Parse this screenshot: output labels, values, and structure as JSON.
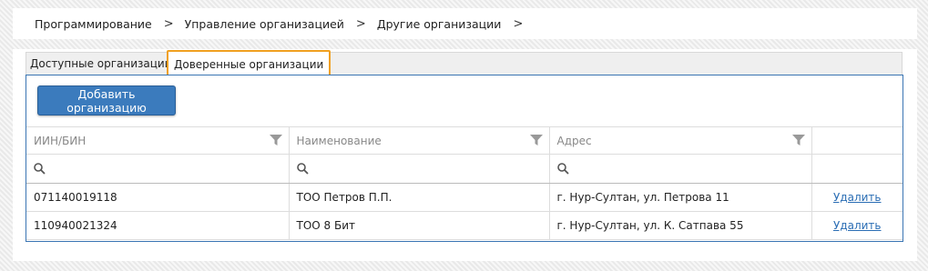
{
  "breadcrumb": [
    {
      "label": "Программирование"
    },
    {
      "label": "Управление организацией"
    },
    {
      "label": "Другие организации"
    }
  ],
  "breadcrumb_separator": ">",
  "tabs": [
    {
      "label": "Доступные организации",
      "active": false
    },
    {
      "label": "Доверенные организации",
      "active": true
    }
  ],
  "add_button_label": "Добавить организацию",
  "table": {
    "columns": [
      {
        "label": "ИИН/БИН",
        "filter_icon": "funnel-icon"
      },
      {
        "label": "Наименование",
        "filter_icon": "funnel-icon"
      },
      {
        "label": "Адрес",
        "filter_icon": "funnel-icon"
      }
    ],
    "search_icon": "search-icon",
    "rows": [
      {
        "iin": "071140019118",
        "name": "ТОО Петров П.П.",
        "address": "г. Нур-Султан, ул. Петрова 11",
        "action": "Удалить"
      },
      {
        "iin": "110940021324",
        "name": "ТОО 8 Бит",
        "address": "г. Нур-Султан, ул. К. Сатпава 55",
        "action": "Удалить"
      }
    ]
  },
  "colors": {
    "accent": "#3b7bbd",
    "active_tab_outline": "#f0a020",
    "link": "#2a6db4"
  }
}
